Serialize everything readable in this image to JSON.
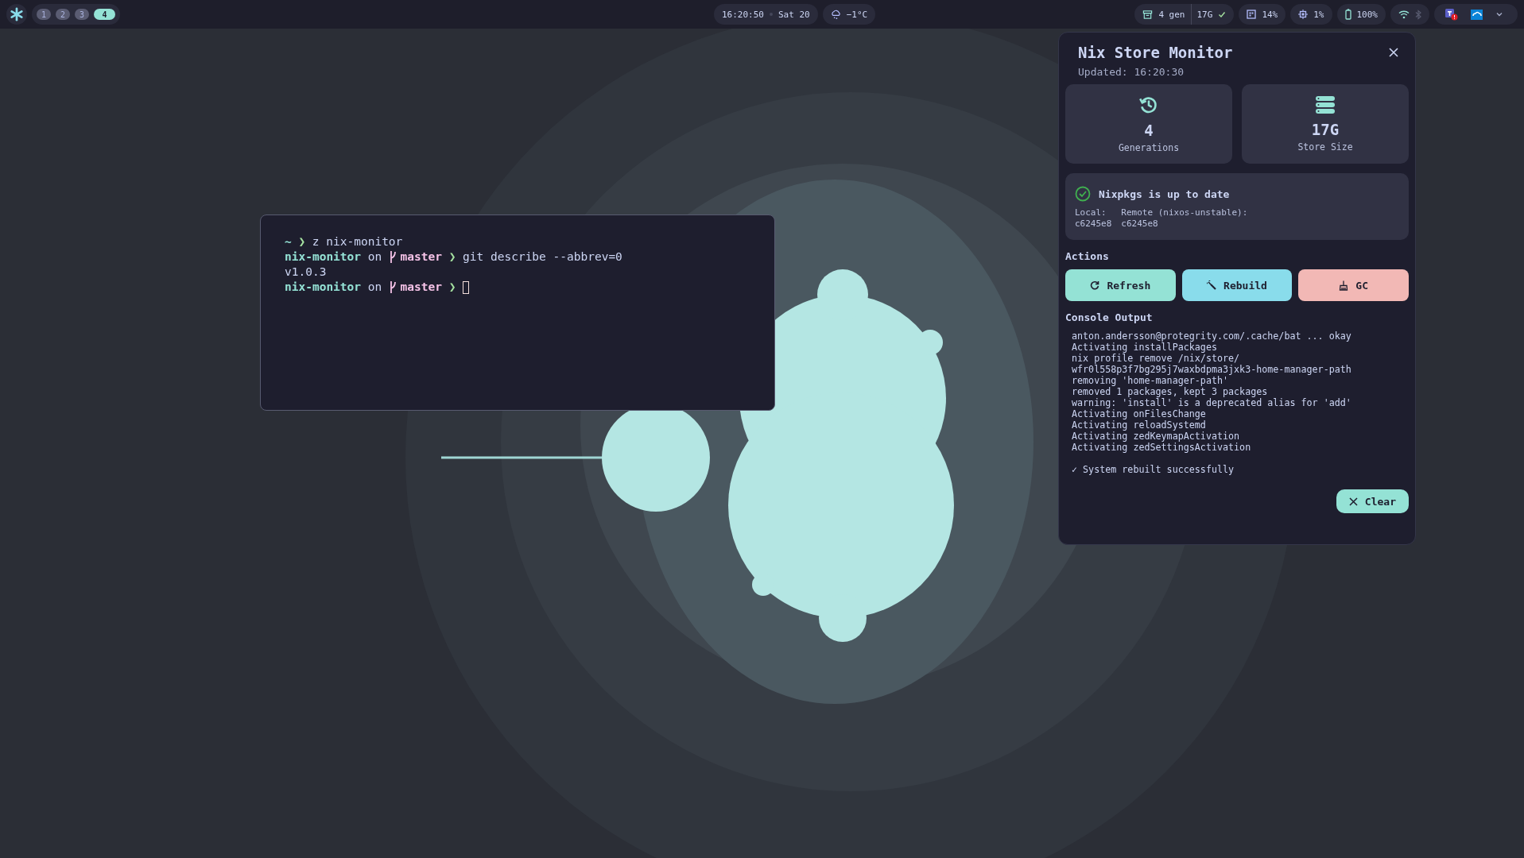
{
  "topbar": {
    "workspaces": [
      {
        "label": "1",
        "selected": false
      },
      {
        "label": "2",
        "selected": false
      },
      {
        "label": "3",
        "selected": false
      },
      {
        "label": "4",
        "selected": true
      }
    ],
    "clock": {
      "time": "16:20:50",
      "date": "Sat 20"
    },
    "weather": "−1°C",
    "nix": {
      "generations": "4 gen",
      "store": "17G"
    },
    "memory": "14%",
    "cpu": "1%",
    "battery": "100%",
    "bluetooth_on": false
  },
  "terminal": {
    "lines": [
      {
        "segments": [
          {
            "kind": "path",
            "text": "~"
          },
          {
            "kind": "arrow",
            "text": "❯"
          },
          {
            "kind": "command",
            "text": "z nix-monitor"
          }
        ]
      },
      {
        "segments": [
          {
            "kind": "dir",
            "text": "nix-monitor"
          },
          {
            "kind": "plain",
            "text": "on"
          },
          {
            "kind": "branch",
            "text": "master"
          },
          {
            "kind": "arrow",
            "text": "❯"
          },
          {
            "kind": "command",
            "text": "git describe --abbrev=0"
          }
        ]
      },
      {
        "segments": [
          {
            "kind": "command",
            "text": "v1.0.3"
          }
        ]
      },
      {
        "segments": [
          {
            "kind": "dir",
            "text": "nix-monitor"
          },
          {
            "kind": "plain",
            "text": "on"
          },
          {
            "kind": "branch",
            "text": "master"
          },
          {
            "kind": "arrow",
            "text": "❯"
          },
          {
            "kind": "cursor"
          }
        ]
      }
    ]
  },
  "panel": {
    "title": "Nix Store Monitor",
    "updated": "Updated: 16:20:30",
    "stats": [
      {
        "kind": "generations",
        "value": "4",
        "label": "Generations"
      },
      {
        "kind": "store",
        "value": "17G",
        "label": "Store Size"
      }
    ],
    "status": {
      "ok": true,
      "message": "Nixpkgs is up to date",
      "local": {
        "label": "Local:",
        "value": "c6245e8"
      },
      "remote": {
        "label": "Remote (nixos-unstable):",
        "value": "c6245e8"
      }
    },
    "actions_title": "Actions",
    "actions": [
      {
        "kind": "refresh",
        "label": "Refresh"
      },
      {
        "kind": "rebuild",
        "label": "Rebuild"
      },
      {
        "kind": "gc",
        "label": "GC"
      }
    ],
    "console_title": "Console Output",
    "console_lines": [
      "anton.andersson@protegrity.com/.cache/bat ... okay",
      "Activating installPackages",
      "nix profile remove /nix/store/",
      "wfr0l558p3f7bg295j7waxbdpma3jxk3-home-manager-path",
      "removing 'home-manager-path'",
      "removed 1 packages, kept 3 packages",
      "warning: 'install' is a deprecated alias for 'add'",
      "Activating onFilesChange",
      "Activating reloadSystemd",
      "Activating zedKeymapActivation",
      "Activating zedSettingsActivation"
    ],
    "result": "✓ System rebuilt successfully",
    "clear_label": "Clear"
  }
}
